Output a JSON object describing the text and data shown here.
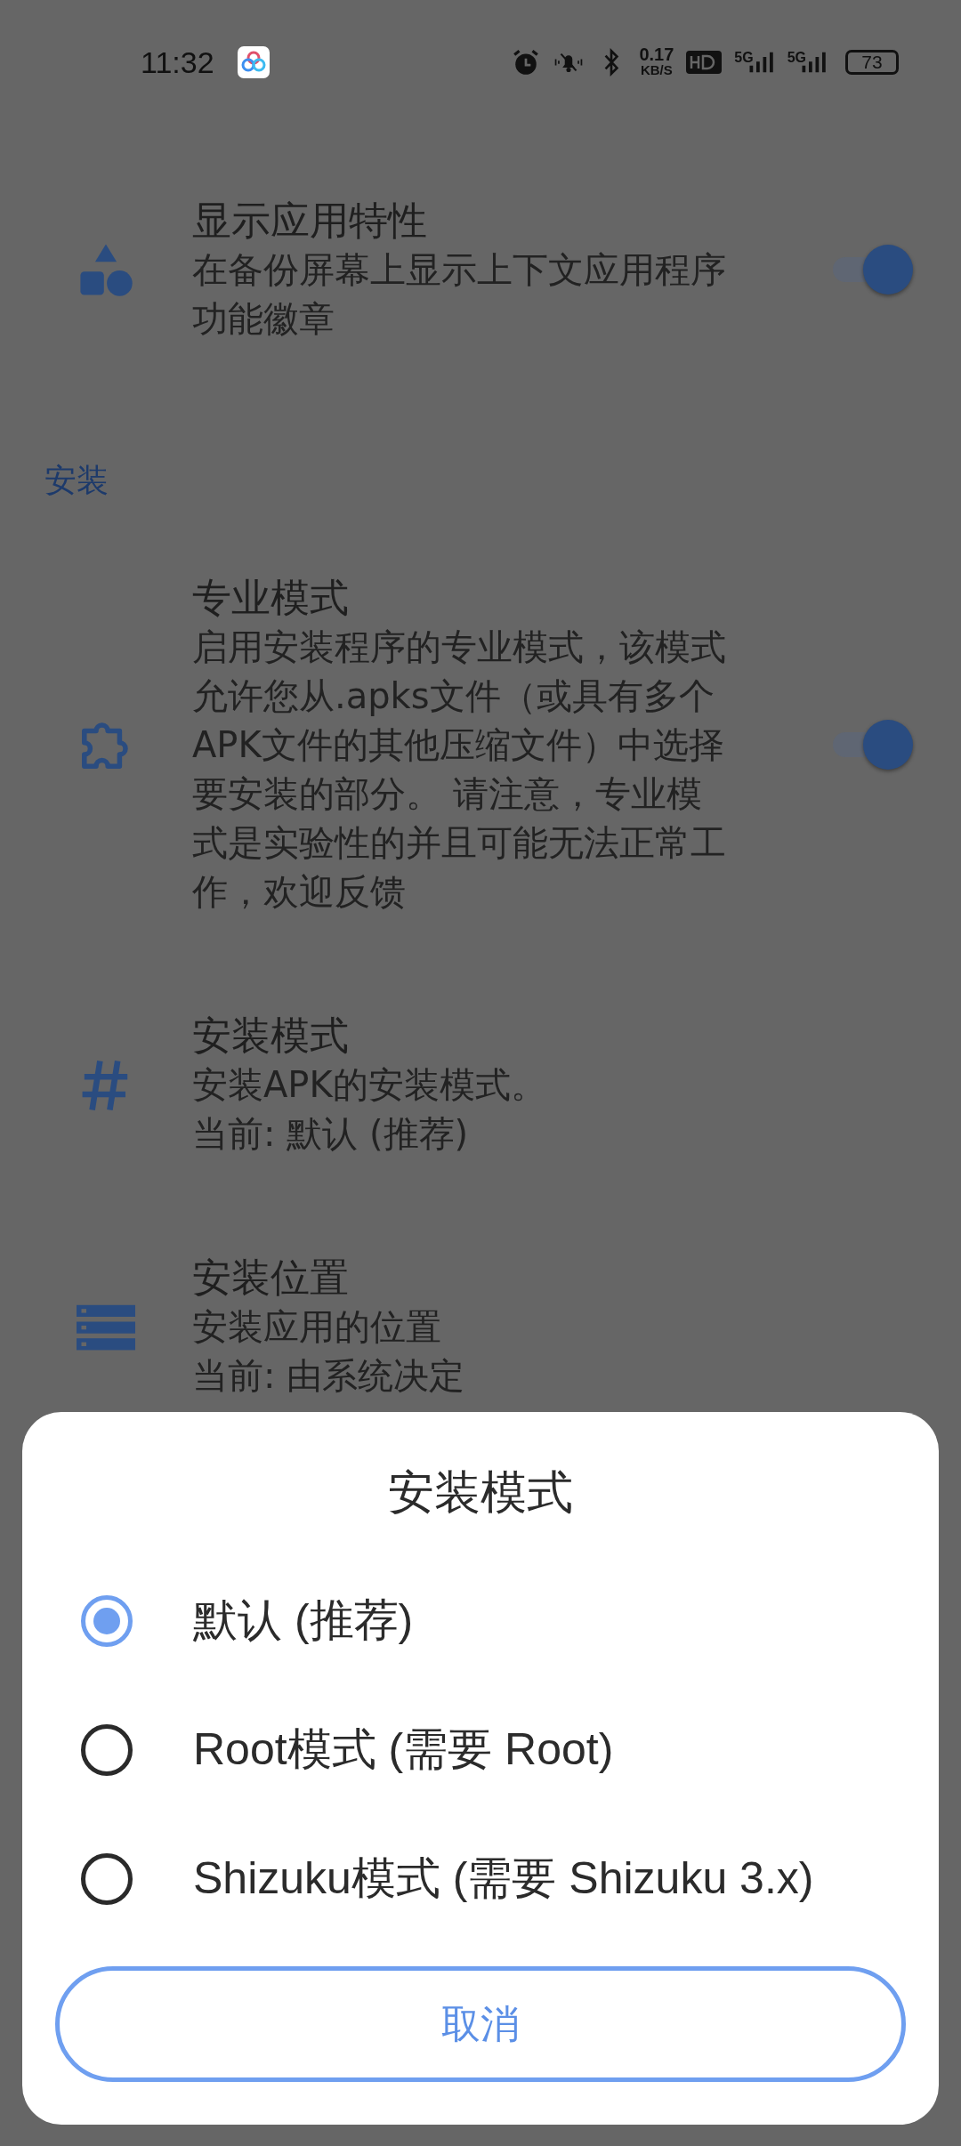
{
  "status_bar": {
    "time": "11:32",
    "network_speed": "0.17",
    "speed_unit": "KB/S",
    "signal_labels": [
      "5G",
      "5G"
    ],
    "battery": "73"
  },
  "settings": [
    {
      "kind": "switch",
      "title": "显示应用特性",
      "summary": "在备份屏幕上显示上下文应用程序功能徽章",
      "on": true
    },
    {
      "kind": "header",
      "title": "安装"
    },
    {
      "kind": "switch",
      "title": "专业模式",
      "summary": "启用安装程序的专业模式，该模式允许您从.apks文件（或具有多个APK文件的其他压缩文件）中选择要安装的部分。 请注意，专业模式是实验性的并且可能无法正常工作，欢迎反馈",
      "on": true
    },
    {
      "kind": "choice",
      "title": "安装模式",
      "summary": "安装APK的安装模式。",
      "current": "当前: 默认 (推荐)"
    },
    {
      "kind": "choice",
      "title": "安装位置",
      "summary": "安装应用的位置",
      "current": "当前: 由系统决定"
    }
  ],
  "dialog": {
    "title": "安装模式",
    "options": [
      {
        "label": "默认 (推荐)",
        "selected": true
      },
      {
        "label": "Root模式 (需要 Root)",
        "selected": false
      },
      {
        "label": "Shizuku模式 (需要 Shizuku 3.x)",
        "selected": false
      }
    ],
    "cancel_button": "取消"
  }
}
